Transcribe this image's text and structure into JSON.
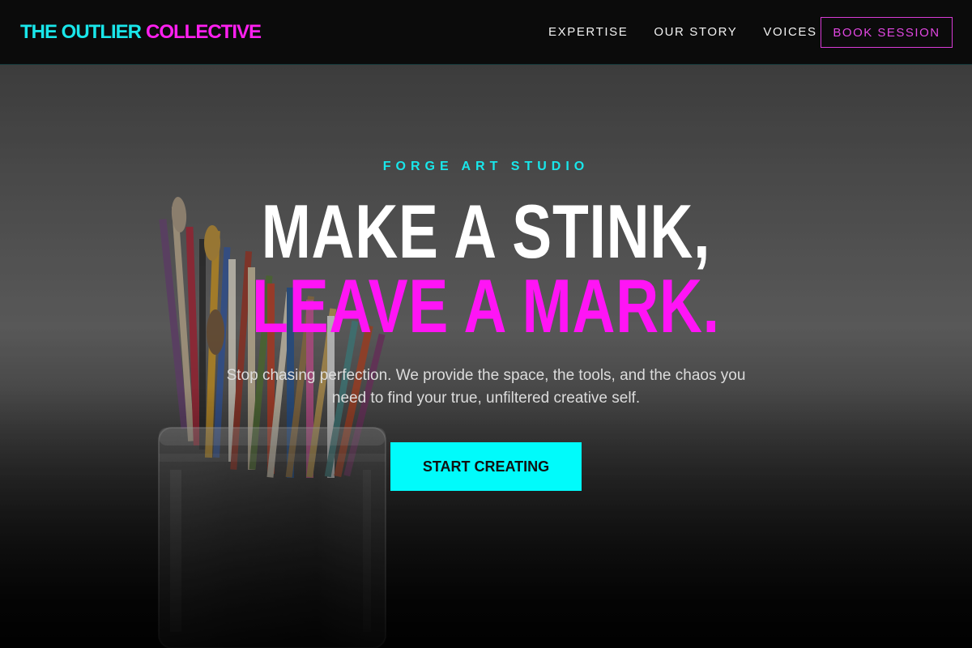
{
  "header": {
    "logo_part1": "THE OUTLIER",
    "logo_part2": "COLLECTIVE",
    "nav": [
      {
        "label": "EXPERTISE"
      },
      {
        "label": "OUR STORY"
      },
      {
        "label": "VOICES"
      }
    ],
    "cta_label": "BOOK SESSION"
  },
  "hero": {
    "eyebrow": "FORGE ART STUDIO",
    "headline_line1": "MAKE A STINK,",
    "headline_line2": "LEAVE A MARK.",
    "subtext": "Stop chasing perfection. We provide the space, the tools, and the chaos you need to find your true, unfiltered creative self.",
    "cta_label": "START CREATING",
    "background_image": "paintbrushes-in-jar"
  },
  "colors": {
    "accent_cyan": "#19e6ea",
    "accent_magenta": "#ff14f5",
    "cta_background": "#00fbfb",
    "nav_background": "#0b0b0b"
  }
}
